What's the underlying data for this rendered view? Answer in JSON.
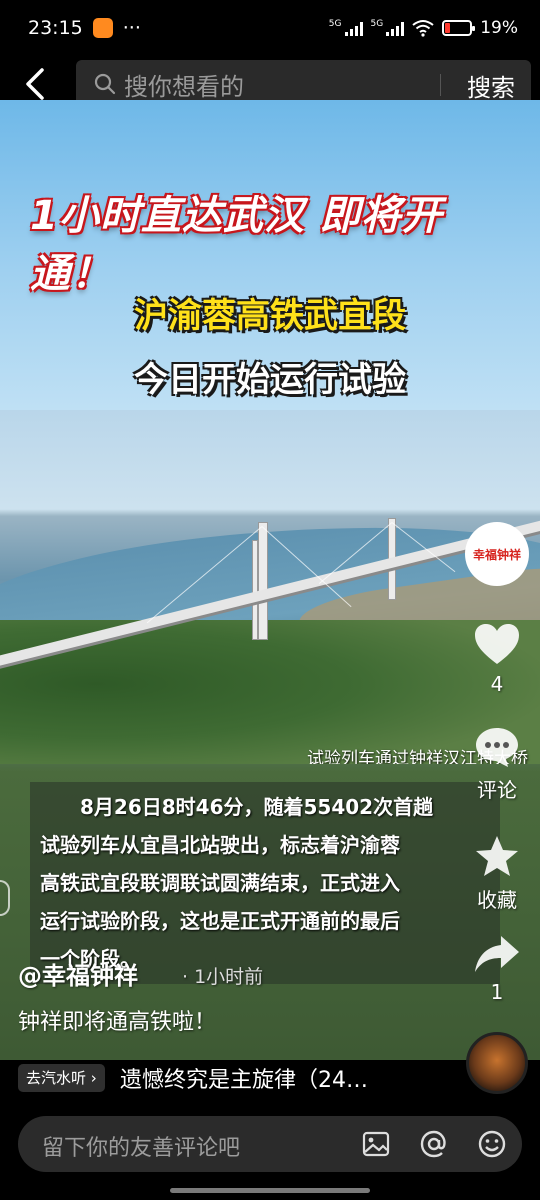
{
  "status_bar": {
    "time": "23:15",
    "more": "···",
    "sig1_label": "5G",
    "sig2_label": "5G",
    "battery": "19%",
    "battery_level": 0.19
  },
  "search": {
    "placeholder": "搜你想看的",
    "button": "搜索"
  },
  "video": {
    "banner": "1小时直达武汉 即将开通！",
    "subtitle1": "沪渝蓉高铁武宜段",
    "subtitle2": "今日开始运行试验",
    "photo_caption": "试验列车通过钟祥汉江特大桥",
    "text_lines": [
      "8月26日8时46分，随着55402次首趟",
      "试验列车从宜昌北站驶出，标志着沪渝蓉",
      "高铁武宜段联调联试圆满结束，正式进入",
      "运行试验阶段，这也是正式开通前的最后",
      "一个阶段。"
    ]
  },
  "sidebar": {
    "avatar_text": "幸福钟祥",
    "likes": "4",
    "comments_label": "评论",
    "favorite_label": "收藏",
    "shares": "1"
  },
  "post": {
    "author": "@幸福钟祥",
    "time": "· 1小时前",
    "description": "钟祥即将通高铁啦！"
  },
  "music": {
    "tag": "去汽水听 ›",
    "title": "遗憾终究是主旋律（24…"
  },
  "comment_bar": {
    "placeholder": "留下你的友善评论吧"
  }
}
